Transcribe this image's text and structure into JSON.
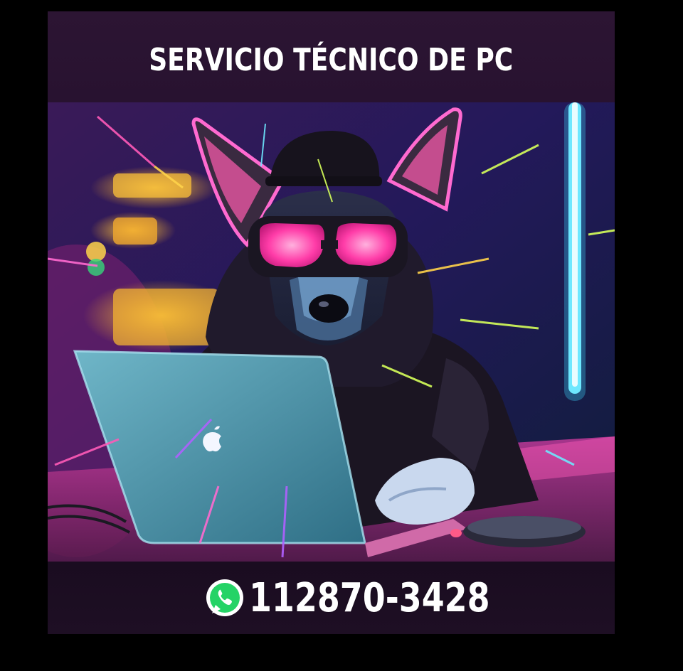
{
  "flyer": {
    "title": "SERVICIO TÉCNICO DE PC",
    "phone": "112870-3428",
    "contact_icon": "whatsapp-icon",
    "image_subject": "dog-with-goggles-using-laptop",
    "colors": {
      "band_top": "#2c1533",
      "band_bottom": "#1a0c20",
      "neon_pink": "#ff3ca8",
      "neon_cyan": "#6ee8ff",
      "whatsapp_green": "#25d366"
    }
  }
}
